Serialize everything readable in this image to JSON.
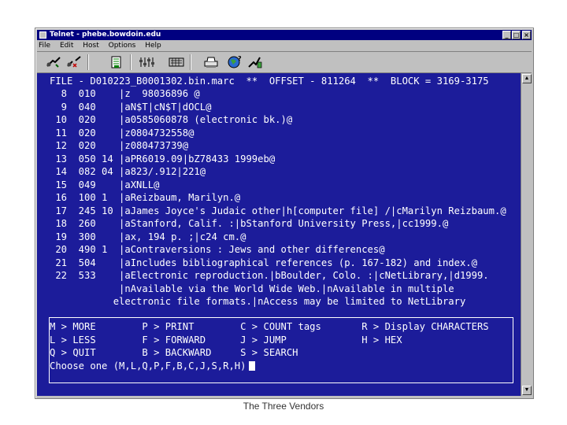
{
  "window": {
    "title": "Telnet - phebe.bowdoin.edu",
    "controls": {
      "minimize": "_",
      "maximize": "□",
      "close": "×"
    }
  },
  "menu": [
    "File",
    "Edit",
    "Host",
    "Options",
    "Help"
  ],
  "toolbar": {
    "icons": [
      "connect-icon",
      "disconnect-icon",
      "log-icon",
      "settings-icon",
      "keyboard-icon",
      "print-icon",
      "help-icon",
      "cursor-help-icon"
    ]
  },
  "terminal": {
    "header": "FILE - D010223_B0001302.bin.marc  **  OFFSET - 811264  **  BLOCK = 3169-3175",
    "lines": [
      "  8  010    |z  98036896 @",
      "  9  040    |aN$T|cN$T|dOCL@",
      " 10  020    |a0585060878 (electronic bk.)@",
      " 11  020    |z0804732558@",
      " 12  020    |z080473739@",
      " 13  050 14 |aPR6019.09|bZ78433 1999eb@",
      " 14  082 04 |a823/.912|221@",
      " 15  049    |aXNLL@",
      " 16  100 1  |aReizbaum, Marilyn.@",
      " 17  245 10 |aJames Joyce's Judaic other|h[computer file] /|cMarilyn Reizbaum.@",
      " 18  260    |aStanford, Calif. :|bStanford University Press,|cc1999.@",
      " 19  300    |ax, 194 p. ;|c24 cm.@",
      " 20  490 1  |aContraversions : Jews and other differences@",
      " 21  504    |aIncludes bibliographical references (p. 167-182) and index.@",
      " 22  533    |aElectronic reproduction.|bBoulder, Colo. :|cNetLibrary,|d1999.",
      "            |nAvailable via the World Wide Web.|nAvailable in multiple",
      "           electronic file formats.|nAccess may be limited to NetLibrary"
    ],
    "commands": [
      "M > MORE        P > PRINT        C > COUNT tags       R > Display CHARACTERS",
      "L > LESS        F > FORWARD      J > JUMP             H > HEX",
      "Q > QUIT        B > BACKWARD     S > SEARCH"
    ],
    "prompt": "Choose one (M,L,Q,P,F,B,C,J,S,R,H)"
  },
  "scrollbar": {
    "up": "▲",
    "down": "▼"
  },
  "caption": "The Three Vendors"
}
